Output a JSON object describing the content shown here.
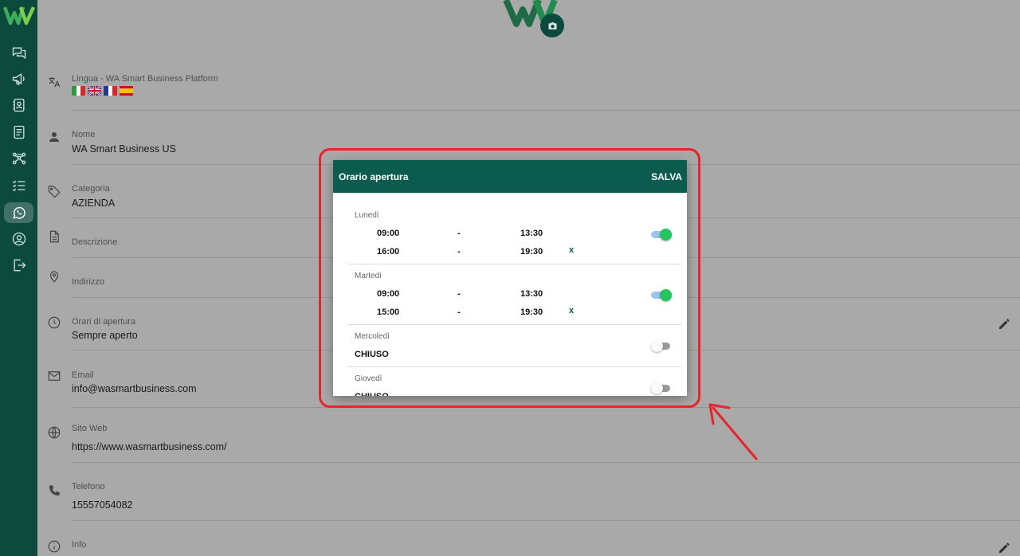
{
  "sidebar": {
    "logo": "wa-logo",
    "items": [
      {
        "icon": "chat-icon"
      },
      {
        "icon": "megaphone-icon"
      },
      {
        "icon": "contacts-icon"
      },
      {
        "icon": "template-icon"
      },
      {
        "icon": "flow-icon"
      },
      {
        "icon": "checklist-icon"
      },
      {
        "icon": "whatsapp-icon",
        "active": true
      },
      {
        "icon": "profile-icon"
      },
      {
        "icon": "logout-icon"
      }
    ]
  },
  "profile": {
    "language_label": "Lingua - WA Smart Business Platform",
    "flags": [
      "it",
      "en",
      "fr",
      "es"
    ],
    "fields": [
      {
        "label": "Nome",
        "value": "WA Smart Business US"
      },
      {
        "label": "Categoria",
        "value": "AZIENDA"
      },
      {
        "label": "Descrizione",
        "value": ""
      },
      {
        "label": "Indirizzo",
        "value": ""
      },
      {
        "label": "Orari di apertura",
        "value": "Sempre aperto"
      },
      {
        "label": "Email",
        "value": "info@wasmartbusiness.com"
      },
      {
        "label": "Sito Web",
        "value": "https://www.wasmartbusiness.com/"
      },
      {
        "label": "Telefono",
        "value": "15557054082"
      },
      {
        "label": "Info",
        "value": ""
      }
    ]
  },
  "dialog": {
    "title": "Orario apertura",
    "save_label": "SALVA",
    "dash": "-",
    "remove_label": "x",
    "closed_label": "CHIUSO",
    "days": [
      {
        "name": "Lunedì",
        "enabled": true,
        "slots": [
          {
            "from": "09:00",
            "to": "13:30"
          },
          {
            "from": "16:00",
            "to": "19:30"
          }
        ]
      },
      {
        "name": "Martedì",
        "enabled": true,
        "slots": [
          {
            "from": "09:00",
            "to": "13:30"
          },
          {
            "from": "15:00",
            "to": "19:30"
          }
        ]
      },
      {
        "name": "Mercoledì",
        "enabled": false,
        "slots": []
      },
      {
        "name": "Giovedì",
        "enabled": false,
        "slots": []
      }
    ]
  },
  "colors": {
    "sidebar": "#0c4a3e",
    "dialog_header": "#0b5c4f",
    "toggle_on": "#22c55e",
    "highlight": "#e8232a"
  }
}
